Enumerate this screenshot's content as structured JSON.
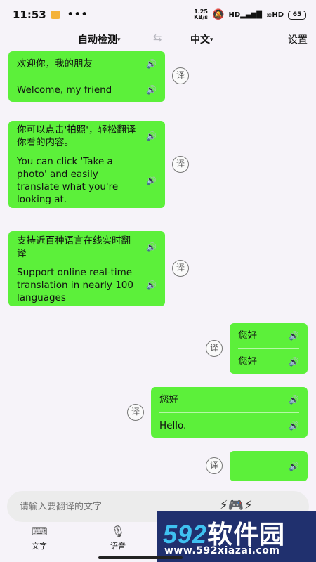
{
  "status_bar": {
    "time": "11:53",
    "dots": "•••",
    "speed_value": "1.25",
    "speed_unit": "KB/s",
    "signal": "HD",
    "wifi": "HD",
    "battery": "65"
  },
  "header": {
    "source_lang": "自动检测",
    "target_lang": "中文",
    "settings": "设置"
  },
  "messages": [
    {
      "side": "left",
      "original": "欢迎你，我的朋友",
      "translation": "Welcome, my friend"
    },
    {
      "side": "left",
      "original": "你可以点击'拍照'，轻松翻译你看的内容。",
      "translation": "You can click 'Take a photo' and easily translate what you're looking at."
    },
    {
      "side": "left",
      "original": "支持近百种语言在线实时翻译",
      "translation": "Support online real-time translation in nearly 100 languages"
    },
    {
      "side": "right",
      "original": "您好",
      "translation": "您好"
    },
    {
      "side": "right",
      "original": "您好",
      "translation": "Hello."
    },
    {
      "side": "right",
      "original": "",
      "translation": ""
    }
  ],
  "translate_badge": "译",
  "input": {
    "placeholder": "请输入要翻译的文字"
  },
  "tabs": [
    {
      "label": "文字",
      "icon": "keyboard-icon"
    },
    {
      "label": "语音",
      "icon": "microphone-icon"
    }
  ],
  "watermark": {
    "brand_num": "592",
    "brand_text": "软件园",
    "url": "www.592xiazai.com"
  },
  "colors": {
    "bubble": "#5cf03a",
    "background": "#f6f3f9",
    "watermark_bg": "#20306e"
  }
}
